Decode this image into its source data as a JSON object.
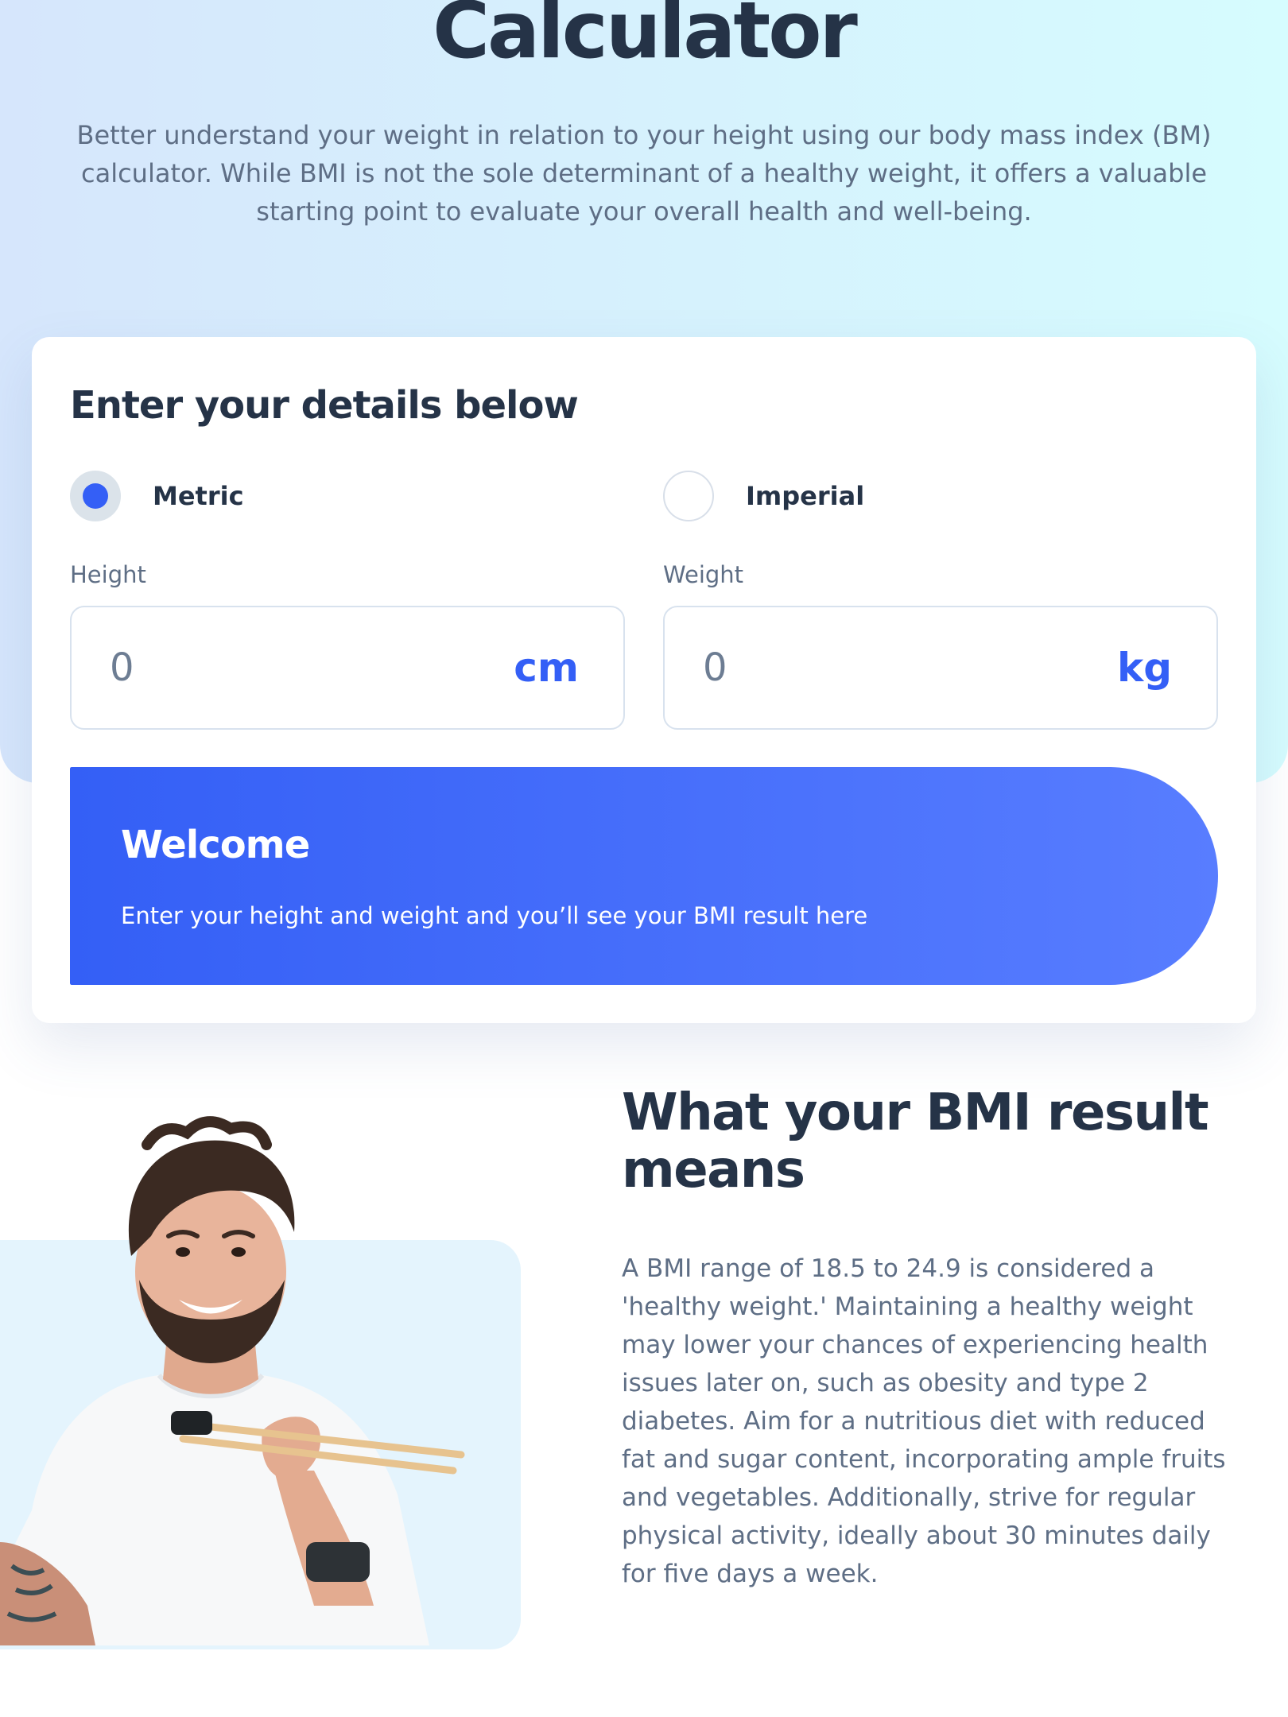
{
  "hero": {
    "title": "Calculator",
    "description": "Better understand your weight in relation to your height using our body mass index (BM) calculator. While BMI is not the sole determinant of a healthy weight, it offers a valuable starting point to evaluate your overall health and well-being."
  },
  "form": {
    "title": "Enter your details below",
    "units": [
      {
        "label": "Metric",
        "selected": true
      },
      {
        "label": "Imperial",
        "selected": false
      }
    ],
    "height": {
      "label": "Height",
      "placeholder": "0",
      "unit": "cm"
    },
    "weight": {
      "label": "Weight",
      "placeholder": "0",
      "unit": "kg"
    }
  },
  "result": {
    "title": "Welcome",
    "description": "Enter your height and weight and you’ll see your BMI result here"
  },
  "meaning": {
    "title": "What your BMI result means",
    "description": "A BMI range of 18.5 to 24.9 is considered a 'healthy weight.' Maintaining a healthy weight may lower your chances of experiencing health issues later on, such as obesity and type 2 diabetes. Aim for a nutritious diet with reduced fat and sugar content, incorporating ample fruits and vegetables. Additionally, strive for regular physical activity, ideally about 30 minutes daily for five days a week."
  },
  "colors": {
    "accent": "#345FF6",
    "heading": "#253347",
    "body": "#5E6E85",
    "hero_gradient_start": "#D6E6FC",
    "hero_gradient_end": "#D6FCFE"
  }
}
